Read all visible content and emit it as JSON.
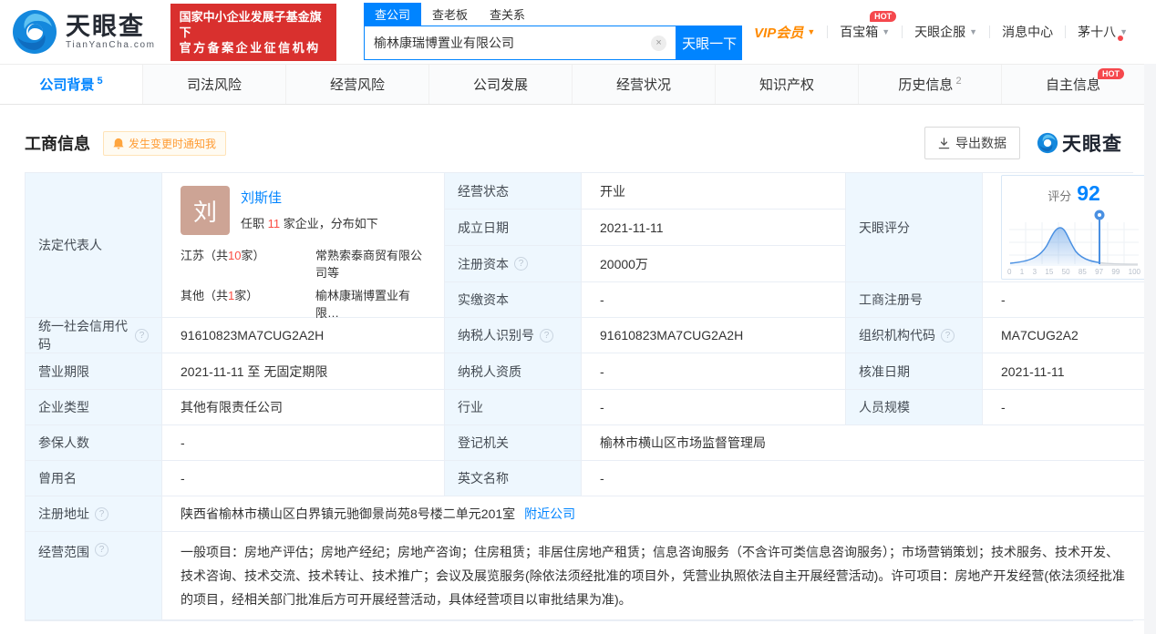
{
  "colors": {
    "accent": "#0084ff",
    "cert_red": "#d9302e",
    "hot_red": "#f5484d",
    "vip_orange": "#ff8a00",
    "count_red": "#fb4e44",
    "label_bg": "#eef7fe",
    "avatar_bg": "#cda495"
  },
  "header": {
    "logo": {
      "brand": "天眼查",
      "domain": "TianYanCha.com"
    },
    "cert": {
      "line1": "国家中小企业发展子基金旗下",
      "line2": "官方备案企业征信机构"
    },
    "search": {
      "tabs": [
        {
          "label": "查公司"
        },
        {
          "label": "查老板"
        },
        {
          "label": "查关系"
        }
      ],
      "value": "榆林康瑞博置业有限公司",
      "clear": "×",
      "button": "天眼一下"
    },
    "menu": {
      "vip": "VIP会员",
      "box": "百宝箱",
      "box_hot": "HOT",
      "service": "天眼企服",
      "messages": "消息中心",
      "user": "茅十八"
    }
  },
  "nav": {
    "tabs": [
      {
        "label": "公司背景",
        "count": "5"
      },
      {
        "label": "司法风险"
      },
      {
        "label": "经营风险"
      },
      {
        "label": "公司发展"
      },
      {
        "label": "经营状况"
      },
      {
        "label": "知识产权"
      },
      {
        "label": "历史信息",
        "count": "2"
      },
      {
        "label": "自主信息",
        "hot": "HOT"
      }
    ]
  },
  "section": {
    "title": "工商信息",
    "notify": "发生变更时通知我",
    "export": "导出数据",
    "brand": "天眼查"
  },
  "legal_rep": {
    "label": "法定代表人",
    "avatar_char": "刘",
    "name": "刘斯佳",
    "tenure_pre": "任职",
    "tenure_count": "11",
    "tenure_post": "家企业，分布如下",
    "dist": [
      {
        "region": "江苏",
        "wrap_pre": "（共",
        "count": "10",
        "wrap_post": "家）",
        "company": "常熟索泰商贸有限公司等"
      },
      {
        "region": "其他",
        "wrap_pre": "（共",
        "count": "1",
        "wrap_post": "家）",
        "company": "榆林康瑞博置业有限…"
      }
    ]
  },
  "fields": {
    "status": {
      "label": "经营状态",
      "value": "开业"
    },
    "est_date": {
      "label": "成立日期",
      "value": "2021-11-11"
    },
    "reg_capital": {
      "label": "注册资本",
      "value": "20000万"
    },
    "paid_capital": {
      "label": "实缴资本",
      "value": "-"
    },
    "score": {
      "label": "天眼评分",
      "prefix": "评分",
      "value": "92"
    },
    "reg_number": {
      "label": "工商注册号",
      "value": "-"
    },
    "credit_code": {
      "label": "统一社会信用代码",
      "value": "91610823MA7CUG2A2H"
    },
    "taxpayer_id": {
      "label": "纳税人识别号",
      "value": "91610823MA7CUG2A2H"
    },
    "org_code": {
      "label": "组织机构代码",
      "value": "MA7CUG2A2"
    },
    "biz_term": {
      "label": "营业期限",
      "value": "2021-11-11 至 无固定期限"
    },
    "taxpayer_qual": {
      "label": "纳税人资质",
      "value": "-"
    },
    "approval_date": {
      "label": "核准日期",
      "value": "2021-11-11"
    },
    "company_type": {
      "label": "企业类型",
      "value": "其他有限责任公司"
    },
    "industry": {
      "label": "行业",
      "value": "-"
    },
    "staff_size": {
      "label": "人员规模",
      "value": "-"
    },
    "insured_count": {
      "label": "参保人数",
      "value": "-"
    },
    "reg_authority": {
      "label": "登记机关",
      "value": "榆林市横山区市场监督管理局"
    },
    "former_name": {
      "label": "曾用名",
      "value": "-"
    },
    "english_name": {
      "label": "英文名称",
      "value": "-"
    },
    "reg_address": {
      "label": "注册地址",
      "value": "陕西省榆林市横山区白界镇元驰御景尚苑8号楼二单元201室",
      "link": "附近公司"
    },
    "business_scope": {
      "label": "经营范围",
      "value": "一般项目：房地产评估；房地产经纪；房地产咨询；住房租赁；非居住房地产租赁；信息咨询服务（不含许可类信息咨询服务）；市场营销策划；技术服务、技术开发、技术咨询、技术交流、技术转让、技术推广；会议及展览服务(除依法须经批准的项目外，凭营业执照依法自主开展经营活动)。许可项目：房地产开发经营(依法须经批准的项目，经相关部门批准后方可开展经营活动，具体经营项目以审批结果为准)。"
    }
  },
  "chart_data": {
    "type": "area",
    "title": "天眼评分",
    "score": 92,
    "x_ticks": [
      "0",
      "1",
      "3",
      "15",
      "50",
      "85",
      "97",
      "99",
      "100"
    ],
    "marker_value": 92,
    "shape": "bell-distribution",
    "legend_position": "none",
    "grid": true
  }
}
